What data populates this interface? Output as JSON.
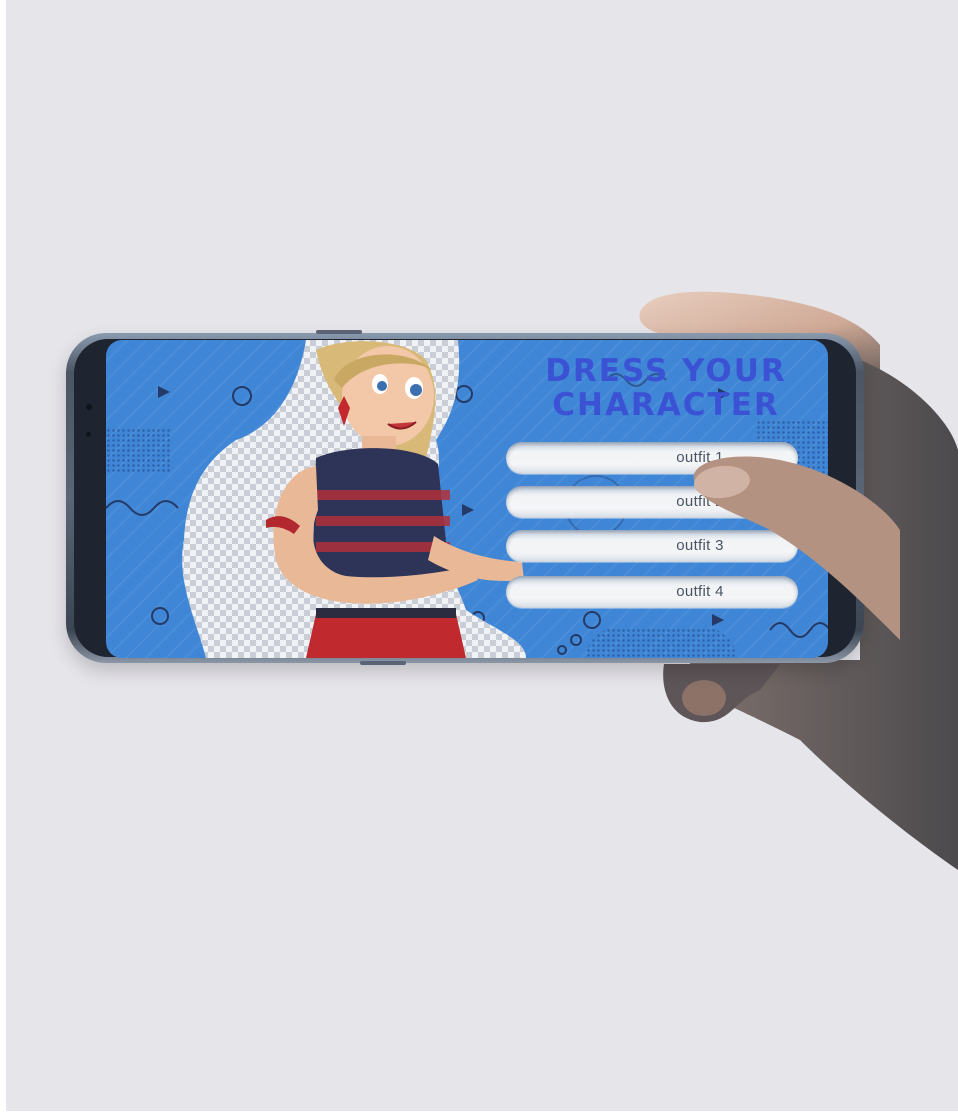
{
  "colors": {
    "background": "#e6e5ea",
    "screen": "#3f86d6",
    "title": "#3b52d4"
  },
  "app": {
    "title_line1": "DRESS YOUR",
    "title_line2": "CHARACTER"
  },
  "outfits": [
    {
      "label": "outfit 1"
    },
    {
      "label": "outfit 2"
    },
    {
      "label": "outfit 3"
    },
    {
      "label": "outfit 4"
    }
  ],
  "icons": [
    "play-triangle-icon",
    "circle-outline-icon",
    "wave-line-icon"
  ]
}
